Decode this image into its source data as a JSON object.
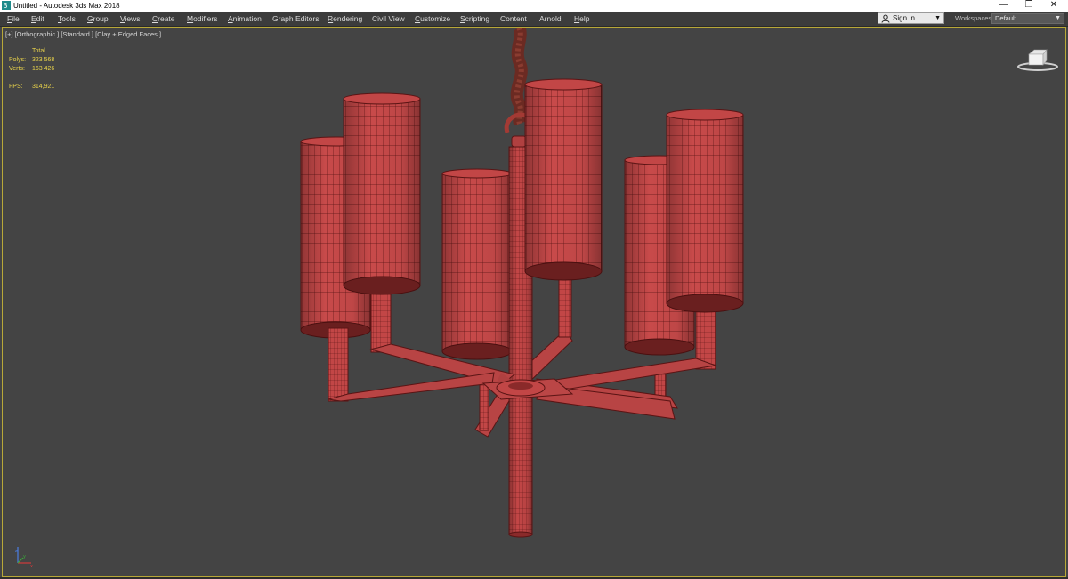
{
  "window": {
    "title": "Untitled - Autodesk 3ds Max 2018",
    "minimize_glyph": "—",
    "restore_glyph": "❐",
    "close_glyph": "✕"
  },
  "menu": {
    "items": [
      {
        "label": "File",
        "u": "F",
        "rest": "ile"
      },
      {
        "label": "Edit",
        "u": "E",
        "rest": "dit"
      },
      {
        "label": "Tools",
        "u": "T",
        "rest": "ools"
      },
      {
        "label": "Group",
        "u": "G",
        "rest": "roup"
      },
      {
        "label": "Views",
        "u": "V",
        "rest": "iews"
      },
      {
        "label": "Create",
        "u": "C",
        "rest": "reate"
      },
      {
        "label": "Modifiers",
        "u": "M",
        "rest": "odifiers"
      },
      {
        "label": "Animation",
        "u": "A",
        "rest": "nimation"
      },
      {
        "label": "Graph Editors",
        "u": "",
        "rest": "Graph Editors"
      },
      {
        "label": "Rendering",
        "u": "R",
        "rest": "endering"
      },
      {
        "label": "Civil View",
        "u": "",
        "rest": "Civil View"
      },
      {
        "label": "Customize",
        "u": "C",
        "rest": "ustomize"
      },
      {
        "label": "Scripting",
        "u": "S",
        "rest": "cripting"
      },
      {
        "label": "Content",
        "u": "",
        "rest": "Content"
      },
      {
        "label": "Arnold",
        "u": "",
        "rest": "Arnold"
      },
      {
        "label": "Help",
        "u": "H",
        "rest": "elp"
      }
    ]
  },
  "signin": {
    "label": "Sign In",
    "icon": "user-icon"
  },
  "workspaces": {
    "label": "Workspaces:",
    "value": "Default"
  },
  "viewport": {
    "label": "[+] [Orthographic ] [Standard ] [Clay + Edged Faces ]",
    "stats": {
      "total_label": "Total",
      "polys_label": "Polys:",
      "polys_value": "323 568",
      "verts_label": "Verts:",
      "verts_value": "163 426",
      "fps_label": "FPS:",
      "fps_value": "314,921"
    }
  },
  "colors": {
    "viewport_bg": "#444444",
    "clay": "#c84a4a",
    "wire": "#5a1414",
    "stats_text": "#e8d24a",
    "active_border": "#b8a838"
  }
}
